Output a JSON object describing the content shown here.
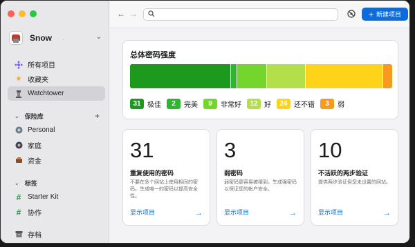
{
  "window": {
    "traffic_lights": [
      "close",
      "minimize",
      "zoom"
    ]
  },
  "account": {
    "name": "Snow",
    "dot": "."
  },
  "sidebar": {
    "items": [
      {
        "label": "所有项目",
        "icon": "all-items-icon"
      },
      {
        "label": "收藏夹",
        "icon": "star-icon"
      },
      {
        "label": "Watchtower",
        "icon": "watchtower-icon",
        "active": true
      }
    ],
    "vaults_header": "保险库",
    "vaults": [
      {
        "label": "Personal",
        "icon": "vault-icon"
      },
      {
        "label": "家庭",
        "icon": "vault-icon"
      },
      {
        "label": "资金",
        "icon": "vault-icon"
      }
    ],
    "tags_header": "标签",
    "tags": [
      {
        "label": "Starter Kit",
        "icon": "tag-icon"
      },
      {
        "label": "协作",
        "icon": "tag-icon"
      }
    ],
    "archive": {
      "label": "存档",
      "icon": "archive-icon"
    }
  },
  "toolbar": {
    "back": "←",
    "forward": "→",
    "search_placeholder": "",
    "new_item_label": "新建项目",
    "new_item_plus": "+"
  },
  "strength": {
    "title": "总体密码强度",
    "segments": [
      {
        "label": "极佳",
        "count": 31,
        "color": "#1d9a1d"
      },
      {
        "label": "完美",
        "count": 2,
        "color": "#2fb52f"
      },
      {
        "label": "非常好",
        "count": 9,
        "color": "#74d62d"
      },
      {
        "label": "好",
        "count": 12,
        "color": "#b3e04a"
      },
      {
        "label": "还不错",
        "count": 24,
        "color": "#ffd31a"
      },
      {
        "label": "弱",
        "count": 3,
        "color": "#f79a1f"
      }
    ]
  },
  "stats": [
    {
      "value": "31",
      "title": "重复使用的密码",
      "desc": "不要在多个网站上使用相同的密码。生成唯一的密码以提高安全性。",
      "link": "显示项目",
      "arrow": "→"
    },
    {
      "value": "3",
      "title": "弱密码",
      "desc": "弱密码更容易被猜到。生成强密码以保证您的帐户安全。",
      "link": "显示项目",
      "arrow": "→"
    },
    {
      "value": "10",
      "title": "不活跃的两步验证",
      "desc": "提供两步验证但您未设置的网站。",
      "link": "显示项目",
      "arrow": "→"
    }
  ]
}
